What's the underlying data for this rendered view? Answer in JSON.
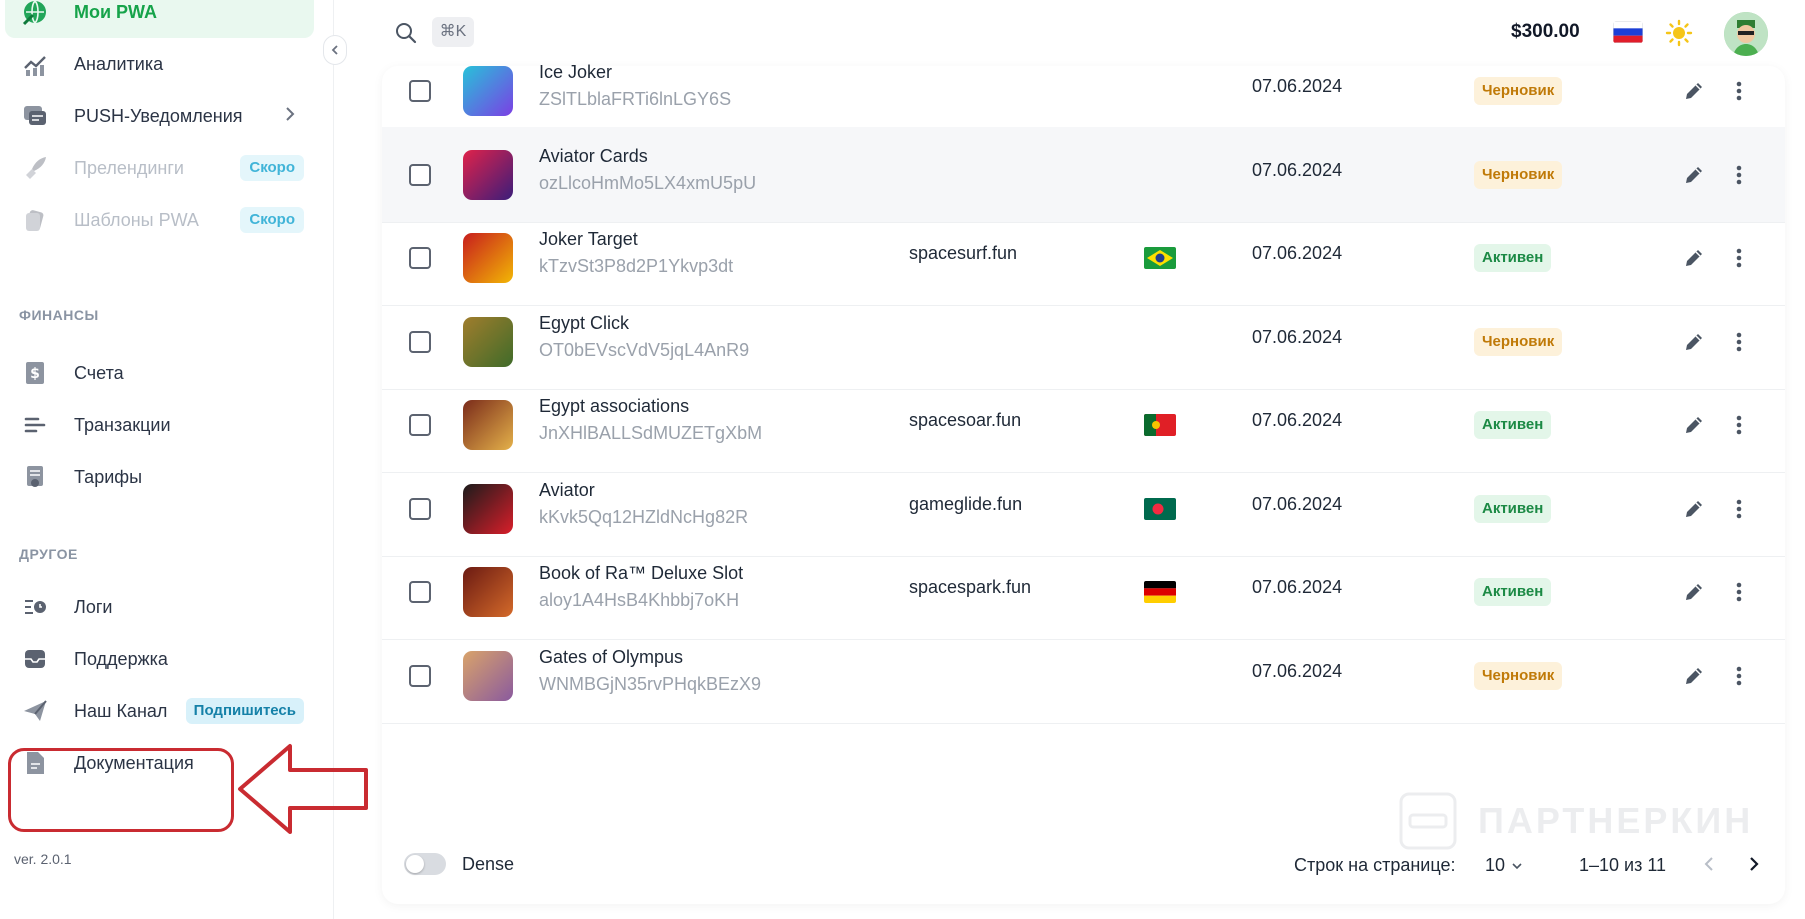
{
  "sidebar": {
    "items": [
      {
        "label": "Мои PWA"
      },
      {
        "label": "Аналитика"
      },
      {
        "label": "PUSH-Уведомления"
      },
      {
        "label": "Прелендинги",
        "badge": "Скоро"
      },
      {
        "label": "Шаблоны PWA",
        "badge": "Скоро"
      },
      {
        "label": "Счета"
      },
      {
        "label": "Транзакции"
      },
      {
        "label": "Тарифы"
      },
      {
        "label": "Логи"
      },
      {
        "label": "Поддержка"
      },
      {
        "label": "Наш Канал",
        "badge": "Подпишитесь"
      },
      {
        "label": "Документация"
      }
    ],
    "sections": {
      "finance": "ФИНАНСЫ",
      "other": "ДРУГОЕ"
    },
    "version": "ver. 2.0.1"
  },
  "topbar": {
    "shortcut": "⌘K",
    "balance": "$300.00",
    "language_flag": "ru",
    "theme_icon": "sun-icon"
  },
  "table": {
    "rows": [
      {
        "name": "Ice Joker",
        "id": "ZSlTLblaFRTi6lnLGY6S",
        "domain": "",
        "flag": "",
        "date": "07.06.2024",
        "status": "Черновик",
        "status_type": "draft"
      },
      {
        "name": "Aviator Cards",
        "id": "ozLlcoHmMo5LX4xmU5pU",
        "domain": "",
        "flag": "",
        "date": "07.06.2024",
        "status": "Черновик",
        "status_type": "draft"
      },
      {
        "name": "Joker Target",
        "id": "kTzvSt3P8d2P1Ykvp3dt",
        "domain": "spacesurf.fun",
        "flag": "br",
        "date": "07.06.2024",
        "status": "Активен",
        "status_type": "active"
      },
      {
        "name": "Egypt Click",
        "id": "OT0bEVscVdV5jqL4AnR9",
        "domain": "",
        "flag": "",
        "date": "07.06.2024",
        "status": "Черновик",
        "status_type": "draft"
      },
      {
        "name": "Egypt associations",
        "id": "JnXHlBALLSdMUZETgXbM",
        "domain": "spacesoar.fun",
        "flag": "pt",
        "date": "07.06.2024",
        "status": "Активен",
        "status_type": "active"
      },
      {
        "name": "Aviator",
        "id": "kKvk5Qq12HZldNcHg82R",
        "domain": "gameglide.fun",
        "flag": "bd",
        "date": "07.06.2024",
        "status": "Активен",
        "status_type": "active"
      },
      {
        "name": "Book of Ra™ Deluxe Slot",
        "id": "aloy1A4HsB4Khbbj7oKH",
        "domain": "spacespark.fun",
        "flag": "de",
        "date": "07.06.2024",
        "status": "Активен",
        "status_type": "active"
      },
      {
        "name": "Gates of Olympus",
        "id": "WNMBGjN35rvPHqkBEzX9",
        "domain": "",
        "flag": "",
        "date": "07.06.2024",
        "status": "Черновик",
        "status_type": "draft"
      }
    ]
  },
  "footer": {
    "dense_label": "Dense",
    "rows_per_page_label": "Строк на странице:",
    "rows_per_page_value": "10",
    "range": "1–10 из 11"
  },
  "watermark": "ПАРТНЕРКИН",
  "colors": {
    "accent": "#16a34a",
    "highlight": "#c92b31"
  }
}
